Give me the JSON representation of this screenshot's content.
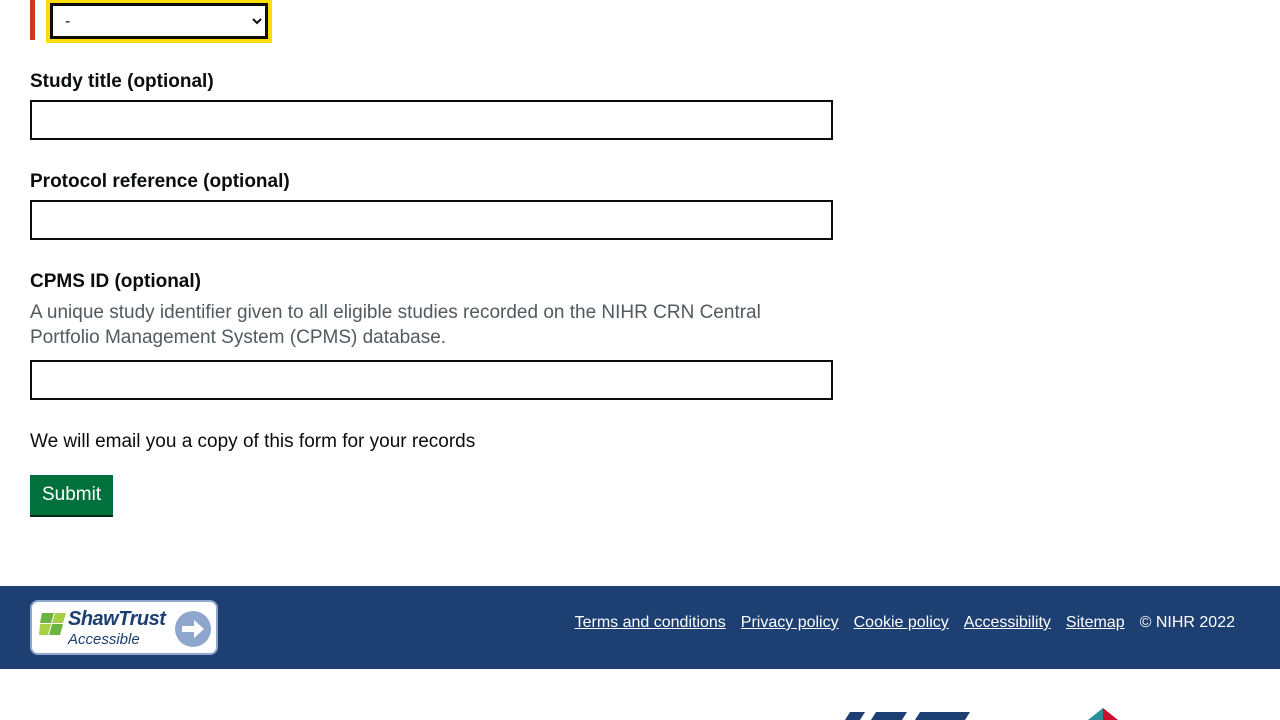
{
  "form": {
    "select_value": "-",
    "study_title_label": "Study title (optional)",
    "protocol_label": "Protocol reference (optional)",
    "cpms_label": "CPMS ID (optional)",
    "cpms_hint": "A unique study identifier given to all eligible studies recorded on the NIHR CRN Central Portfolio Management System (CPMS) database.",
    "email_note": "We will email you a copy of this form for your records",
    "submit_label": "Submit"
  },
  "footer": {
    "badge_title": "ShawTrust",
    "badge_subtitle": "Accessible",
    "links": [
      "Terms and conditions",
      "Privacy policy",
      "Cookie policy",
      "Accessibility",
      "Sitemap"
    ],
    "copyright": "© NIHR 2022"
  },
  "colors": {
    "error": "#d4351c",
    "focus": "#ffdd00",
    "submit": "#00703c",
    "footer": "#1d3f72"
  }
}
